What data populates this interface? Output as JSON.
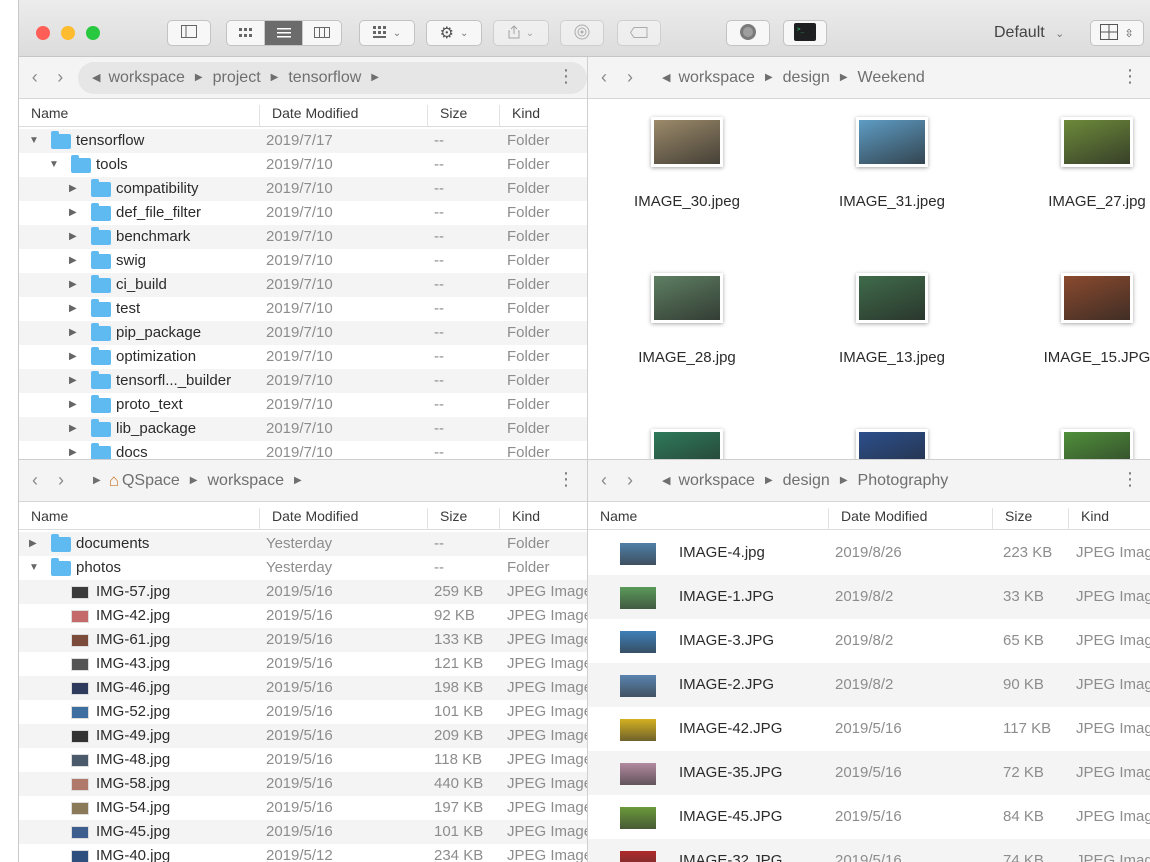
{
  "toolbar": {
    "view_preset": "Default",
    "colors": {
      "close": "#ff5f57",
      "minimize": "#febc2e",
      "zoom": "#28c840",
      "selected_segment": "#6b6b6b"
    },
    "buttons": [
      "sidebar-icon",
      "icon-view-icon",
      "list-view-icon",
      "column-view-icon",
      "group-icon",
      "action-gear-icon",
      "share-icon",
      "airdrop-icon",
      "tag-icon",
      "network-icon",
      "terminal-icon",
      "layout-icon"
    ]
  },
  "pane_tl": {
    "path": [
      "workspace",
      "project",
      "tensorflow"
    ],
    "columns": [
      "Name",
      "Date Modified",
      "Size",
      "Kind"
    ],
    "rows": [
      {
        "name": "tensorflow",
        "date": "2019/7/17",
        "size": "--",
        "kind": "Folder",
        "level": 0,
        "open": true
      },
      {
        "name": "tools",
        "date": "2019/7/10",
        "size": "--",
        "kind": "Folder",
        "level": 1,
        "open": true
      },
      {
        "name": "compatibility",
        "date": "2019/7/10",
        "size": "--",
        "kind": "Folder",
        "level": 2
      },
      {
        "name": "def_file_filter",
        "date": "2019/7/10",
        "size": "--",
        "kind": "Folder",
        "level": 2
      },
      {
        "name": "benchmark",
        "date": "2019/7/10",
        "size": "--",
        "kind": "Folder",
        "level": 2
      },
      {
        "name": "swig",
        "date": "2019/7/10",
        "size": "--",
        "kind": "Folder",
        "level": 2
      },
      {
        "name": "ci_build",
        "date": "2019/7/10",
        "size": "--",
        "kind": "Folder",
        "level": 2
      },
      {
        "name": "test",
        "date": "2019/7/10",
        "size": "--",
        "kind": "Folder",
        "level": 2
      },
      {
        "name": "pip_package",
        "date": "2019/7/10",
        "size": "--",
        "kind": "Folder",
        "level": 2
      },
      {
        "name": "optimization",
        "date": "2019/7/10",
        "size": "--",
        "kind": "Folder",
        "level": 2
      },
      {
        "name": "tensorfl..._builder",
        "date": "2019/7/10",
        "size": "--",
        "kind": "Folder",
        "level": 2
      },
      {
        "name": "proto_text",
        "date": "2019/7/10",
        "size": "--",
        "kind": "Folder",
        "level": 2
      },
      {
        "name": "lib_package",
        "date": "2019/7/10",
        "size": "--",
        "kind": "Folder",
        "level": 2
      },
      {
        "name": "docs",
        "date": "2019/7/10",
        "size": "--",
        "kind": "Folder",
        "level": 2
      }
    ]
  },
  "pane_tr": {
    "path": [
      "workspace",
      "design",
      "Weekend"
    ],
    "items": [
      {
        "name": "IMAGE_30.jpeg",
        "color": "#9c8a6a"
      },
      {
        "name": "IMAGE_31.jpeg",
        "color": "#5e9cc4"
      },
      {
        "name": "IMAGE_27.jpg",
        "color": "#6d8a3a"
      },
      {
        "name": "IMAGE_28.jpg",
        "color": "#5e7f62"
      },
      {
        "name": "IMAGE_13.jpeg",
        "color": "#3f6b4a"
      },
      {
        "name": "IMAGE_15.JPG",
        "color": "#8a4a2e"
      },
      {
        "name": "",
        "color": "#2e7a5a"
      },
      {
        "name": "",
        "color": "#2c4f8c"
      },
      {
        "name": "",
        "color": "#4f8f3a"
      }
    ]
  },
  "pane_bl": {
    "path": [
      "QSpace",
      "workspace"
    ],
    "columns": [
      "Name",
      "Date Modified",
      "Size",
      "Kind"
    ],
    "rows": [
      {
        "name": "documents",
        "date": "Yesterday",
        "size": "--",
        "kind": "Folder",
        "level": 0,
        "type": "folder"
      },
      {
        "name": "photos",
        "date": "Yesterday",
        "size": "--",
        "kind": "Folder",
        "level": 0,
        "type": "folder",
        "open": true
      },
      {
        "name": "IMG-57.jpg",
        "date": "2019/5/16",
        "size": "259 KB",
        "kind": "JPEG Image",
        "level": 1,
        "type": "file",
        "color": "#3b3b3b"
      },
      {
        "name": "IMG-42.jpg",
        "date": "2019/5/16",
        "size": "92 KB",
        "kind": "JPEG Image",
        "level": 1,
        "type": "file",
        "color": "#c46a6a"
      },
      {
        "name": "IMG-61.jpg",
        "date": "2019/5/16",
        "size": "133 KB",
        "kind": "JPEG Image",
        "level": 1,
        "type": "file",
        "color": "#7a4a3a"
      },
      {
        "name": "IMG-43.jpg",
        "date": "2019/5/16",
        "size": "121 KB",
        "kind": "JPEG Image",
        "level": 1,
        "type": "file",
        "color": "#555"
      },
      {
        "name": "IMG-46.jpg",
        "date": "2019/5/16",
        "size": "198 KB",
        "kind": "JPEG Image",
        "level": 1,
        "type": "file",
        "color": "#2e3b5c"
      },
      {
        "name": "IMG-52.jpg",
        "date": "2019/5/16",
        "size": "101 KB",
        "kind": "JPEG Image",
        "level": 1,
        "type": "file",
        "color": "#3e6fa0"
      },
      {
        "name": "IMG-49.jpg",
        "date": "2019/5/16",
        "size": "209 KB",
        "kind": "JPEG Image",
        "level": 1,
        "type": "file",
        "color": "#333"
      },
      {
        "name": "IMG-48.jpg",
        "date": "2019/5/16",
        "size": "118 KB",
        "kind": "JPEG Image",
        "level": 1,
        "type": "file",
        "color": "#4a5a6a"
      },
      {
        "name": "IMG-58.jpg",
        "date": "2019/5/16",
        "size": "440 KB",
        "kind": "JPEG Image",
        "level": 1,
        "type": "file",
        "color": "#b07a6a"
      },
      {
        "name": "IMG-54.jpg",
        "date": "2019/5/16",
        "size": "197 KB",
        "kind": "JPEG Image",
        "level": 1,
        "type": "file",
        "color": "#8a7a5a"
      },
      {
        "name": "IMG-45.jpg",
        "date": "2019/5/16",
        "size": "101 KB",
        "kind": "JPEG Image",
        "level": 1,
        "type": "file",
        "color": "#3e5e8e"
      },
      {
        "name": "IMG-40.jpg",
        "date": "2019/5/12",
        "size": "234 KB",
        "kind": "JPEG Image",
        "level": 1,
        "type": "file",
        "color": "#2f4f7f"
      }
    ]
  },
  "pane_br": {
    "path": [
      "workspace",
      "design",
      "Photography"
    ],
    "columns": [
      "Name",
      "Date Modified",
      "Size",
      "Kind"
    ],
    "rows": [
      {
        "name": "IMAGE-4.jpg",
        "date": "2019/8/26",
        "size": "223 KB",
        "kind": "JPEG Image",
        "color": "#4f7fa8"
      },
      {
        "name": "IMAGE-1.JPG",
        "date": "2019/8/2",
        "size": "33 KB",
        "kind": "JPEG Image",
        "color": "#5a9a5a"
      },
      {
        "name": "IMAGE-3.JPG",
        "date": "2019/8/2",
        "size": "65 KB",
        "kind": "JPEG Image",
        "color": "#3e7fb8"
      },
      {
        "name": "IMAGE-2.JPG",
        "date": "2019/8/2",
        "size": "90 KB",
        "kind": "JPEG Image",
        "color": "#5a84b0"
      },
      {
        "name": "IMAGE-42.JPG",
        "date": "2019/5/16",
        "size": "117 KB",
        "kind": "JPEG Image",
        "color": "#d4b020"
      },
      {
        "name": "IMAGE-35.JPG",
        "date": "2019/5/16",
        "size": "72 KB",
        "kind": "JPEG Image",
        "color": "#b28aa0"
      },
      {
        "name": "IMAGE-45.JPG",
        "date": "2019/5/16",
        "size": "84 KB",
        "kind": "JPEG Image",
        "color": "#6a9a3a"
      },
      {
        "name": "IMAGE-32.JPG",
        "date": "2019/5/16",
        "size": "74 KB",
        "kind": "JPEG Image",
        "color": "#b02a2a"
      }
    ]
  }
}
